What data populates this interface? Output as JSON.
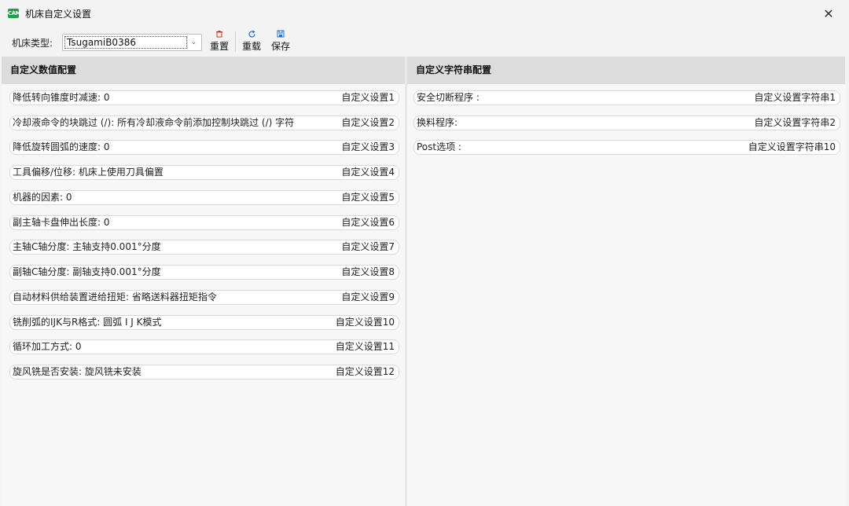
{
  "window": {
    "title": "机床自定义设置",
    "app_icon_text": "CAM",
    "close_symbol": "✕"
  },
  "toolbar": {
    "machine_type_label": "机床类型:",
    "machine_type_value": "TsugamiB0386",
    "reset_label": "重置",
    "reload_label": "重载",
    "save_label": "保存",
    "accent_color": "#1e6fd0",
    "reset_color": "#c0392b"
  },
  "left_panel": {
    "header": "自定义数值配置",
    "rows": [
      {
        "label": "降低转向锥度时减速:   0",
        "name": "自定义设置1"
      },
      {
        "label": "冷却液命令的块跳过 (/):   所有冷却液命令前添加控制块跳过 (/) 字符",
        "name": "自定义设置2"
      },
      {
        "label": "降低旋转圆弧的速度:   0",
        "name": "自定义设置3"
      },
      {
        "label": "工具偏移/位移:   机床上使用刀具偏置",
        "name": "自定义设置4"
      },
      {
        "label": "机器的因素:   0",
        "name": "自定义设置5"
      },
      {
        "label": "副主轴卡盘伸出长度:   0",
        "name": "自定义设置6"
      },
      {
        "label": "主轴C轴分度:   主轴支持0.001°分度",
        "name": "自定义设置7"
      },
      {
        "label": "副轴C轴分度:   副轴支持0.001°分度",
        "name": "自定义设置8"
      },
      {
        "label": "自动材料供给装置进给扭矩:   省略送料器扭矩指令",
        "name": "自定义设置9"
      },
      {
        "label": "铣削弧的IJK与R格式:   圆弧 I J K模式",
        "name": "自定义设置10"
      },
      {
        "label": "循环加工方式:   0",
        "name": "自定义设置11"
      },
      {
        "label": "旋风铣是否安装:   旋风铣未安装",
        "name": "自定义设置12"
      }
    ]
  },
  "right_panel": {
    "header": "自定义字符串配置",
    "rows": [
      {
        "label": "安全切断程序 :",
        "name": "自定义设置字符串1"
      },
      {
        "label": "换料程序:",
        "name": "自定义设置字符串2"
      },
      {
        "label": "Post选项 :",
        "name": "自定义设置字符串10"
      }
    ]
  }
}
